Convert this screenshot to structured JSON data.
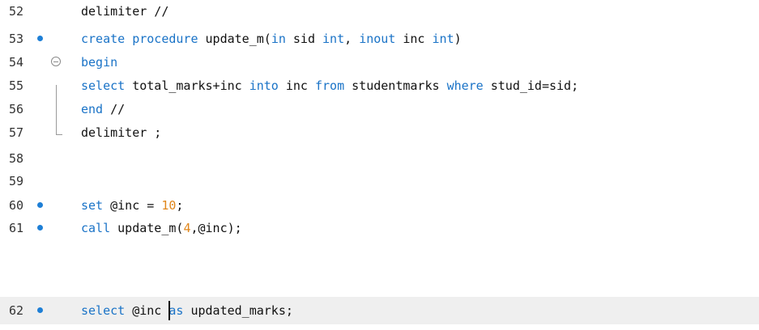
{
  "editor": {
    "lines": [
      {
        "number": "52",
        "breakpoint": false,
        "tokens": [
          {
            "t": "delimiter //",
            "c": "plain"
          }
        ]
      },
      {
        "number": "53",
        "breakpoint": true,
        "tokens": [
          {
            "t": "create procedure",
            "c": "kw"
          },
          {
            "t": " update_m(",
            "c": "plain"
          },
          {
            "t": "in",
            "c": "kw"
          },
          {
            "t": " sid ",
            "c": "plain"
          },
          {
            "t": "int",
            "c": "kw"
          },
          {
            "t": ", ",
            "c": "plain"
          },
          {
            "t": "inout",
            "c": "kw"
          },
          {
            "t": " inc ",
            "c": "plain"
          },
          {
            "t": "int",
            "c": "kw"
          },
          {
            "t": ")",
            "c": "plain"
          }
        ]
      },
      {
        "number": "54",
        "breakpoint": false,
        "fold": true,
        "tokens": [
          {
            "t": "begin",
            "c": "kw"
          }
        ]
      },
      {
        "number": "55",
        "breakpoint": false,
        "tokens": [
          {
            "t": "select",
            "c": "kw"
          },
          {
            "t": " total_marks+inc ",
            "c": "plain"
          },
          {
            "t": "into",
            "c": "kw"
          },
          {
            "t": " inc ",
            "c": "plain"
          },
          {
            "t": "from",
            "c": "kw"
          },
          {
            "t": " studentmarks ",
            "c": "plain"
          },
          {
            "t": "where",
            "c": "kw"
          },
          {
            "t": " stud_id=sid;",
            "c": "plain"
          }
        ]
      },
      {
        "number": "56",
        "breakpoint": false,
        "tokens": [
          {
            "t": "end",
            "c": "kw"
          },
          {
            "t": " //",
            "c": "plain"
          }
        ]
      },
      {
        "number": "57",
        "breakpoint": false,
        "tokens": [
          {
            "t": "delimiter ;",
            "c": "plain"
          }
        ]
      },
      {
        "number": "58",
        "breakpoint": false,
        "tokens": []
      },
      {
        "number": "59",
        "breakpoint": false,
        "tokens": []
      },
      {
        "number": "60",
        "breakpoint": true,
        "tokens": [
          {
            "t": "set",
            "c": "kw"
          },
          {
            "t": " @inc = ",
            "c": "plain"
          },
          {
            "t": "10",
            "c": "num"
          },
          {
            "t": ";",
            "c": "plain"
          }
        ]
      },
      {
        "number": "61",
        "breakpoint": true,
        "tokens": [
          {
            "t": "call",
            "c": "kw"
          },
          {
            "t": " update_m(",
            "c": "plain"
          },
          {
            "t": "4",
            "c": "num"
          },
          {
            "t": ",@inc);",
            "c": "plain"
          }
        ]
      },
      {
        "number": "62",
        "breakpoint": true,
        "current": true,
        "tokens": [
          {
            "t": "select",
            "c": "kw"
          },
          {
            "t": " @inc ",
            "c": "plain"
          },
          {
            "t": "as",
            "c": "kw"
          },
          {
            "t": " updated_marks;",
            "c": "plain"
          }
        ]
      }
    ],
    "cursor": {
      "line": "62",
      "column": 12
    },
    "colors": {
      "keyword": "#1a73c7",
      "number": "#e0861a",
      "text": "#111111",
      "line_number": "#333333",
      "breakpoint": "#1e7fd6",
      "current_line": "#efefef"
    }
  }
}
